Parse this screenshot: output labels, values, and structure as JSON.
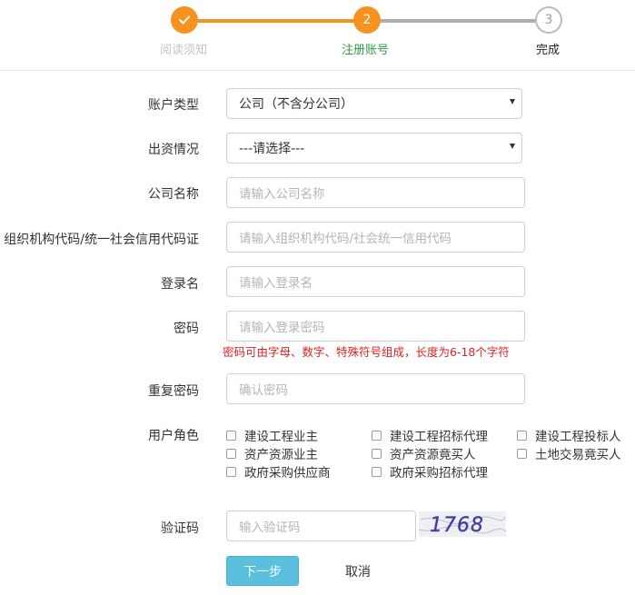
{
  "steps": [
    {
      "label": "阅读须知",
      "icon": "check-icon",
      "status": "done"
    },
    {
      "label": "注册账号",
      "number": "2",
      "status": "active"
    },
    {
      "label": "完成",
      "number": "3",
      "status": "pending"
    }
  ],
  "colors": {
    "accent": "#f6921e",
    "active_label": "#2e9b4b",
    "hint": "#e02020",
    "primary_button": "#5bc0de"
  },
  "form": {
    "account_type": {
      "label": "账户类型",
      "value": "公司（不含分公司）"
    },
    "funding": {
      "label": "出资情况",
      "value": "---请选择---"
    },
    "company_name": {
      "label": "公司名称",
      "placeholder": "请输入公司名称"
    },
    "org_code": {
      "label": "组织机构代码/统一社会信用代码证",
      "placeholder": "请输入组织机构代码/社会统一信用代码"
    },
    "login_name": {
      "label": "登录名",
      "placeholder": "请输入登录名"
    },
    "password": {
      "label": "密码",
      "placeholder": "请输入登录密码",
      "hint": "密码可由字母、数字、特殊符号组成，长度为6-18个字符"
    },
    "confirm_password": {
      "label": "重复密码",
      "placeholder": "确认密码"
    },
    "roles": {
      "label": "用户角色",
      "options": [
        "建设工程业主",
        "建设工程招标代理",
        "建设工程投标人",
        "资产资源业主",
        "资产资源竟买人",
        "土地交易竟买人",
        "政府采购供应商",
        "政府采购招标代理"
      ]
    },
    "captcha": {
      "label": "验证码",
      "placeholder": "输入验证码",
      "image_text": "1768"
    }
  },
  "buttons": {
    "next": "下一步",
    "cancel": "取消"
  }
}
